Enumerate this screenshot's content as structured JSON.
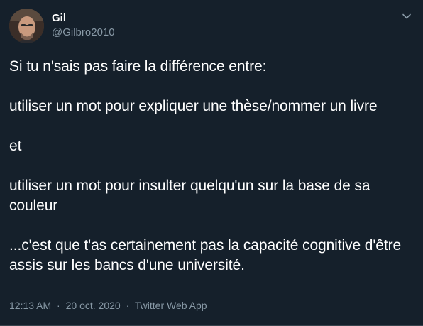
{
  "author": {
    "name": "Gil",
    "handle": "@Gilbro2010"
  },
  "tweet": {
    "paragraphs": [
      "Si tu n'sais pas faire la différence entre:",
      "utiliser un mot pour expliquer une thèse/nommer un livre",
      "et",
      "utiliser un mot pour insulter quelqu'un sur la base de sa couleur",
      "...c'est que t'as certainement pas la capacité cognitive d'être assis sur les bancs d'une université."
    ],
    "time": "12:13 AM",
    "separator": "·",
    "date": "20 oct. 2020",
    "source": "Twitter Web App"
  },
  "icons": {
    "more": "chevron-down-icon",
    "avatar": "avatar-photo"
  },
  "colors": {
    "background": "#15202b",
    "text": "#ffffff",
    "secondary": "#8899a6"
  }
}
